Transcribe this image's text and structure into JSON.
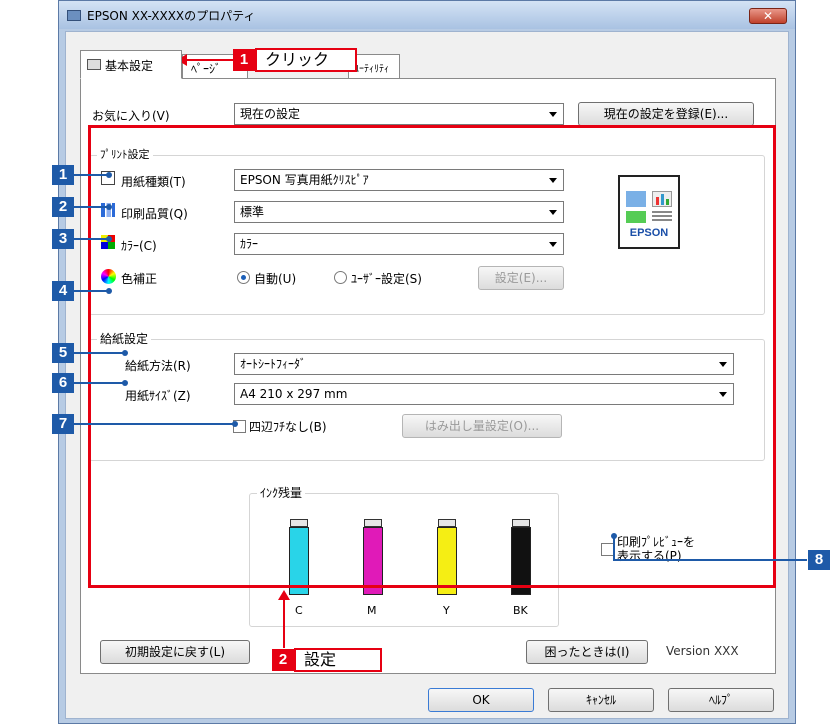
{
  "window": {
    "title": "EPSON XX-XXXXのプロパティ",
    "close_label": "✕"
  },
  "tabs": [
    {
      "label": "基本設定",
      "active": true
    },
    {
      "label": "ﾍﾟｰｼﾞ",
      "active": false
    },
    {
      "label": "ﾕｰﾃｨﾘﾃｨ",
      "active": false
    }
  ],
  "favorites": {
    "label": "お気に入り(V)",
    "value": "現在の設定",
    "register_button": "現在の設定を登録(E)..."
  },
  "print_settings": {
    "group_label": "ﾌﾟﾘﾝﾄ設定",
    "paper_type": {
      "label": "用紙種類(T)",
      "value": "EPSON 写真用紙ｸﾘｽﾋﾟｱ"
    },
    "print_quality": {
      "label": "印刷品質(Q)",
      "value": "標準"
    },
    "color": {
      "label": "ｶﾗｰ(C)",
      "value": "ｶﾗｰ"
    },
    "color_correction": {
      "label": "色補正",
      "auto_label": "自動(U)",
      "user_label": "ﾕｰｻﾞｰ設定(S)",
      "setting_button": "設定(E)..."
    },
    "printer_icon_label": "EPSON"
  },
  "paper_feed": {
    "group_label": "給紙設定",
    "source": {
      "label": "給紙方法(R)",
      "value": "ｵｰﾄｼｰﾄﾌｨｰﾀﾞ"
    },
    "size": {
      "label": "用紙ｻｲｽﾞ(Z)",
      "value": "A4 210 x 297 mm"
    },
    "borderless": {
      "label": "四辺ﾌﾁなし(B)",
      "checked": false
    },
    "expansion_button": "はみ出し量設定(O)..."
  },
  "ink": {
    "group_label": "ｲﾝｸ残量",
    "cartridges": [
      {
        "name": "C",
        "color": "#29d4e8"
      },
      {
        "name": "M",
        "color": "#e01ab8"
      },
      {
        "name": "Y",
        "color": "#f5ee14"
      },
      {
        "name": "BK",
        "color": "#111111"
      }
    ]
  },
  "preview": {
    "label_line1": "印刷ﾌﾟﾚﾋﾞｭｰを",
    "label_line2": "表示する(P)",
    "checked": false
  },
  "bottom": {
    "reset_button": "初期設定に戻す(L)",
    "help_button": "困ったときは(I)",
    "version": "Version XXX"
  },
  "dialog_buttons": {
    "ok": "OK",
    "cancel": "ｷｬﾝｾﾙ",
    "help": "ﾍﾙﾌﾟ"
  },
  "annotations": {
    "callout1": {
      "badge": "1",
      "text": "クリック"
    },
    "callout2": {
      "badge": "2",
      "text": "設定"
    },
    "markers": [
      "1",
      "2",
      "3",
      "4",
      "5",
      "6",
      "7",
      "8"
    ],
    "colors": {
      "red": "#e60012",
      "blue": "#1e5aa8"
    }
  }
}
